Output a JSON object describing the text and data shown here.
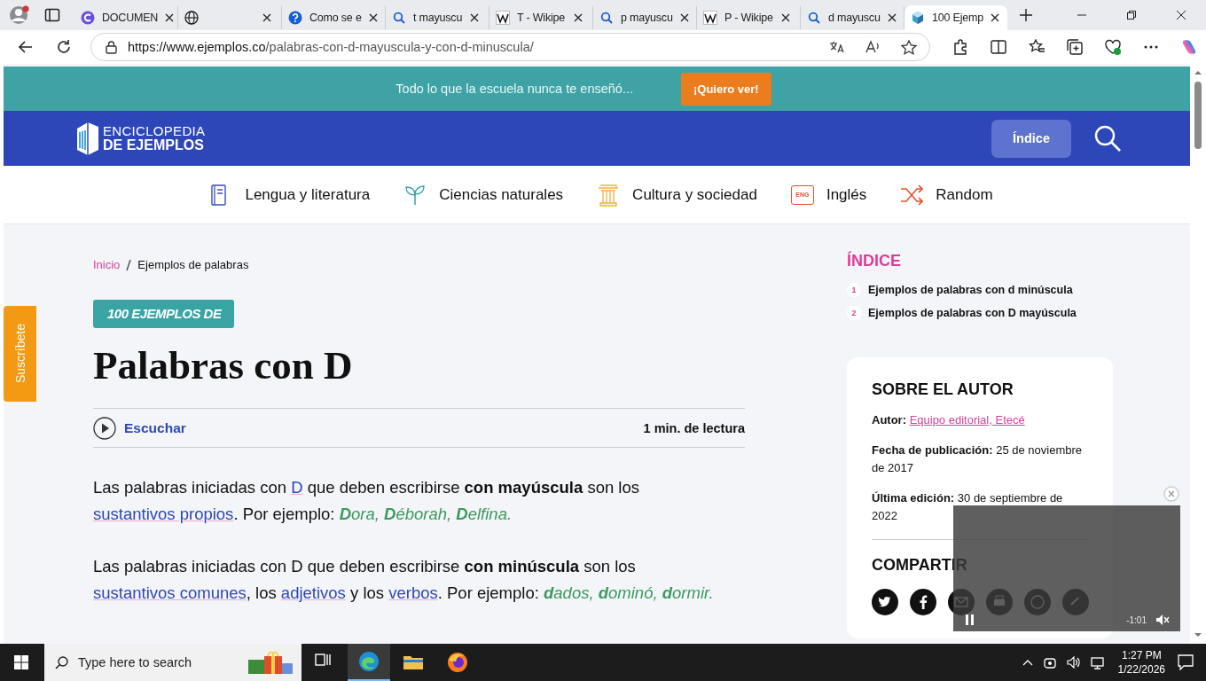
{
  "browser": {
    "tabs": [
      {
        "title": "DOCUMEN",
        "kind": "copilot",
        "selected": false
      },
      {
        "kind": "globe",
        "selected": false
      },
      {
        "title": "Como se e",
        "kind": "help",
        "selected": false
      },
      {
        "title": "t mayuscu",
        "kind": "search",
        "selected": false
      },
      {
        "title": "T - Wikipe",
        "kind": "wiki",
        "selected": false
      },
      {
        "title": "p mayuscu",
        "kind": "search",
        "selected": false
      },
      {
        "title": "P - Wikipe",
        "kind": "wiki",
        "selected": false
      },
      {
        "title": "d mayuscu",
        "kind": "search",
        "selected": false
      },
      {
        "title": "100 Ejemp",
        "kind": "site",
        "selected": true
      }
    ],
    "url": {
      "host": "https://www.ejemplos.co",
      "path": "/palabras-con-d-mayuscula-y-con-d-minuscula/"
    }
  },
  "promo": {
    "text": "Todo lo que la escuela nunca te enseñó...",
    "button": "¡Quiero ver!"
  },
  "header": {
    "logo_top": "ENCICLOPEDIA",
    "logo_bottom": "DE EJEMPLOS",
    "index_button": "Índice"
  },
  "nav": [
    {
      "label": "Lengua y literatura",
      "kind": "book"
    },
    {
      "label": "Ciencias naturales",
      "kind": "plant"
    },
    {
      "label": "Cultura y sociedad",
      "kind": "column"
    },
    {
      "label": "Inglés",
      "kind": "bubble",
      "badge": "ENG"
    },
    {
      "label": "Random",
      "kind": "shuffle"
    }
  ],
  "subscribe": "Suscríbete",
  "breadcrumb": [
    {
      "label": "Inicio",
      "kind": "link"
    },
    {
      "label": "Ejemplos de palabras",
      "kind": "current"
    }
  ],
  "article": {
    "badge": "100 EJEMPLOS DE",
    "title": "Palabras con D",
    "listen": "Escuchar",
    "reading_time": "1 min. de lectura",
    "paragraphs": [
      [
        {
          "text": "Las palabras iniciadas con ",
          "kind": "plain"
        },
        {
          "text": "D",
          "kind": "link"
        },
        {
          "text": " que deben escribirse ",
          "kind": "plain"
        },
        {
          "text": "con mayúscula",
          "kind": "bold"
        },
        {
          "text": " son los ",
          "kind": "plain"
        },
        {
          "text": "sustantivos propios",
          "kind": "link"
        },
        {
          "text": ". Por ejemplo: ",
          "kind": "plain"
        },
        {
          "text": "**D**ora, **D**éborah, **D**elfina.",
          "kind": "example"
        }
      ],
      [
        {
          "text": "Las palabras iniciadas con D que deben escribirse ",
          "kind": "plain"
        },
        {
          "text": "con minúscula",
          "kind": "bold"
        },
        {
          "text": " son los ",
          "kind": "plain"
        },
        {
          "text": "sustantivos comunes",
          "kind": "link"
        },
        {
          "text": ", los ",
          "kind": "plain"
        },
        {
          "text": "adjetivos",
          "kind": "link"
        },
        {
          "text": " y los ",
          "kind": "plain"
        },
        {
          "text": "verbos",
          "kind": "link"
        },
        {
          "text": ". Por ejemplo: ",
          "kind": "plain"
        },
        {
          "text": "**d**ados, **d**ominó, **d**ormir.",
          "kind": "example"
        }
      ]
    ]
  },
  "sidebar": {
    "index_title": "ÍNDICE",
    "index_items": [
      {
        "number": "1",
        "label": "Ejemplos de palabras con d minúscula"
      },
      {
        "number": "2",
        "label": "Ejemplos de palabras con D mayúscula"
      }
    ],
    "author_card": {
      "title": "SOBRE EL AUTOR",
      "fields": [
        {
          "label": "Autor:",
          "value": "Equipo editorial, Etecé",
          "kind": "link"
        },
        {
          "label": "Fecha de publicación:",
          "value": "25 de noviembre de 2017",
          "kind": "text"
        },
        {
          "label": "Última edición:",
          "value": "30 de septiembre de 2022",
          "kind": "text"
        }
      ],
      "share_title": "COMPARTIR",
      "share": [
        {
          "kind": "twitter"
        },
        {
          "kind": "facebook"
        },
        {
          "kind": "email"
        },
        {
          "kind": "print"
        },
        {
          "kind": "whatsapp"
        },
        {
          "kind": "link"
        }
      ]
    }
  },
  "video": {
    "time": "-1:01",
    "playing": true,
    "muted": true
  },
  "taskbar": {
    "search_placeholder": "Type here to search",
    "apps": [
      {
        "kind": "taskview",
        "active": false
      },
      {
        "kind": "edge",
        "active": true
      },
      {
        "kind": "folder",
        "active": false
      },
      {
        "kind": "firefox",
        "active": false
      }
    ],
    "time": "1:27 PM",
    "date": "1/22/2026"
  }
}
